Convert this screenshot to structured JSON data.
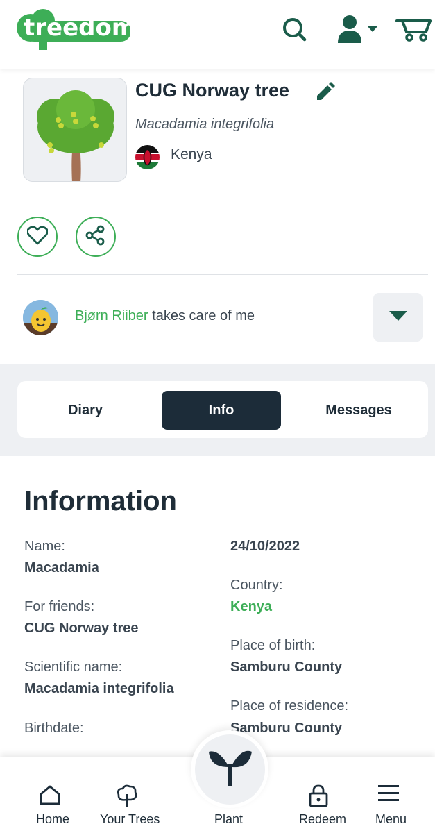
{
  "header": {
    "logo_text": "treedom",
    "icons": [
      "search-icon",
      "user-icon",
      "cart-icon"
    ],
    "brand_color": "#3dae57",
    "icon_color": "#1a5c4a"
  },
  "tree": {
    "name": "CUG Norway tree",
    "scientific_name": "Macadamia integrifolia",
    "country": "Kenya"
  },
  "actions": [
    "heart-icon",
    "share-icon"
  ],
  "caretaker": {
    "name": "Bjørn Riiber",
    "suffix": "takes care of me"
  },
  "tabs": [
    {
      "label": "Diary",
      "active": false
    },
    {
      "label": "Info",
      "active": true
    },
    {
      "label": "Messages",
      "active": false
    }
  ],
  "info": {
    "title": "Information",
    "name_label": "Name:",
    "name_value": "Macadamia",
    "friends_label": "For friends:",
    "friends_value": "CUG Norway tree",
    "sci_label": "Scientific name:",
    "sci_value": "Macadamia integrifolia",
    "birthdate_label": "Birthdate:",
    "birthdate_value": "24/10/2022",
    "country_label": "Country:",
    "country_value": "Kenya",
    "birth_place_label": "Place of birth:",
    "birth_place_value": "Samburu County",
    "residence_label": "Place of residence:",
    "residence_value": "Samburu County"
  },
  "nav": {
    "home": "Home",
    "trees": "Your Trees",
    "plant": "Plant",
    "redeem": "Redeem",
    "menu": "Menu"
  }
}
